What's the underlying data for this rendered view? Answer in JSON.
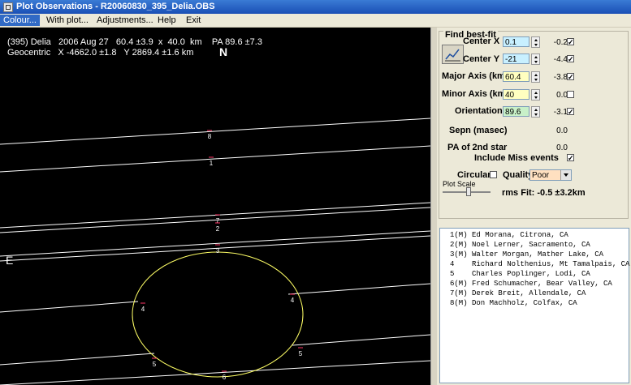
{
  "window": {
    "title": "Plot Observations - R20060830_395_Delia.OBS"
  },
  "menu": [
    "Colour...",
    "With plot...",
    "Adjustments...",
    "Help",
    "Exit"
  ],
  "plot": {
    "header_line1": "(395) Delia   2006 Aug 27   60.4 ±3.9  x  40.0  km    PA 89.6 ±7.3",
    "header_line2": "Geocentric   X -4662.0 ±1.8   Y 2869.4 ±1.6 km",
    "north_label": "N",
    "east_label": "E",
    "chord_labels": [
      "8",
      "1",
      "7",
      "2",
      "3",
      "4",
      "4",
      "5",
      "5",
      "6"
    ],
    "background": "#000000",
    "ellipse_color": "#ffff66",
    "chord_color": "#ffffff",
    "marker_color": "#ff3366"
  },
  "panel": {
    "group_title": "Find best-fit",
    "fit_button_icon": "graph-icon",
    "params": [
      {
        "label": "Center X",
        "value": "0.1",
        "delta": "-0.2",
        "checked": "✓",
        "bg": "#c8f0ff"
      },
      {
        "label": "Center Y",
        "value": "-21",
        "delta": "-4.4",
        "checked": "✓",
        "bg": "#c8f0ff"
      },
      {
        "label": "Major Axis (km)",
        "value": "60.4",
        "delta": "-3.8",
        "checked": "✓",
        "bg": "#ffffc0"
      },
      {
        "label": "Minor Axis (km)",
        "value": "40",
        "delta": "0.0",
        "checked": "",
        "bg": "#ffffc0"
      },
      {
        "label": "Orientation",
        "value": "89.6",
        "delta": "-3.1",
        "checked": "✓",
        "bg": "#c8f0c8"
      }
    ],
    "sepn_label": "Sepn (masec)",
    "sepn_value": "0.0",
    "pa2_label": "PA of 2nd star",
    "pa2_value": "0.0",
    "include_miss_label": "Include Miss events",
    "include_miss_checked": "✓",
    "circular_label": "Circular",
    "quality_label": "Quality",
    "quality_value": "Poor",
    "plot_scale_label": "Plot Scale",
    "rms_fit": "rms Fit: -0.5 ±3.2km"
  },
  "observers": [
    "1(M) Ed Morana, Citrona, CA",
    "2(M) Noel Lerner, Sacramento, CA",
    "3(M) Walter Morgan, Mather Lake, CA",
    "4    Richard Nolthenius, Mt Tamalpais, CA",
    "5    Charles Poplinger, Lodi, CA",
    "6(M) Fred Schumacher, Bear Valley, CA",
    "7(M) Derek Breit, Allendale, CA",
    "8(M) Don Machholz, Colfax, CA"
  ]
}
